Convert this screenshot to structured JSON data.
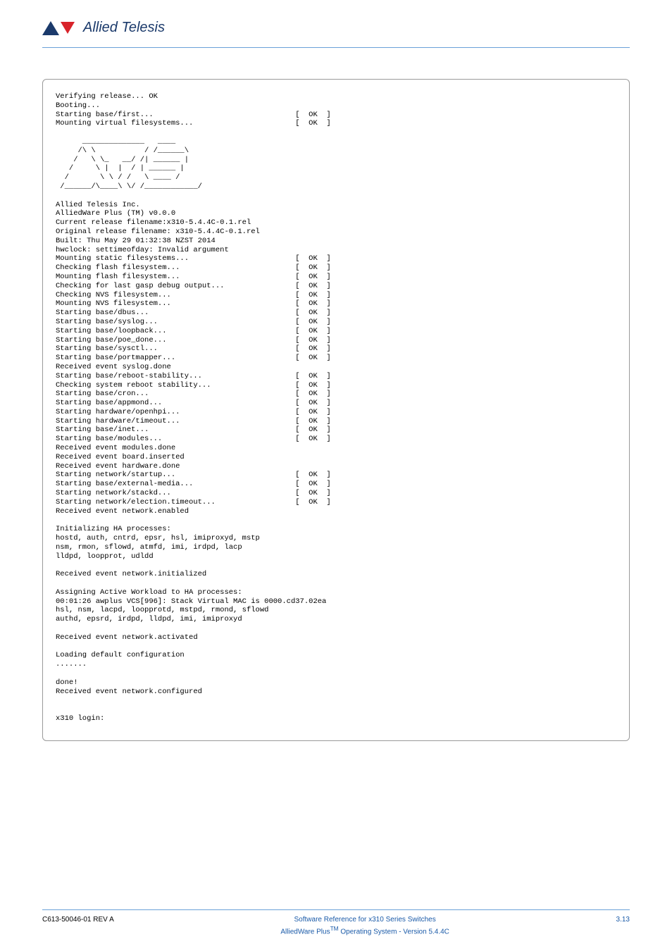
{
  "brand": "Allied Telesis",
  "terminal": "Verifying release... OK\nBooting...\nStarting base/first...                                [  OK  ]\nMounting virtual filesystems...                       [  OK  ]\n\n      ______________   ____\n     /\\ \\           / /______\\\n    /   \\ \\_   __/ /| ______ |\n   /     \\ |  |  / | ______ |\n  /       \\ \\ / /   \\ ____ /\n /______/\\____\\ \\/ /____________/\n\nAllied Telesis Inc.\nAlliedWare Plus (TM) v0.0.0\nCurrent release filename:x310-5.4.4C-0.1.rel\nOriginal release filename: x310-5.4.4C-0.1.rel\nBuilt: Thu May 29 01:32:38 NZST 2014\nhwclock: settimeofday: Invalid argument\nMounting static filesystems...                        [  OK  ]\nChecking flash filesystem...                          [  OK  ]\nMounting flash filesystem...                          [  OK  ]\nChecking for last gasp debug output...                [  OK  ]\nChecking NVS filesystem...                            [  OK  ]\nMounting NVS filesystem...                            [  OK  ]\nStarting base/dbus...                                 [  OK  ]\nStarting base/syslog...                               [  OK  ]\nStarting base/loopback...                             [  OK  ]\nStarting base/poe_done...                             [  OK  ]\nStarting base/sysctl...                               [  OK  ]\nStarting base/portmapper...                           [  OK  ]\nReceived event syslog.done\nStarting base/reboot-stability...                     [  OK  ]\nChecking system reboot stability...                   [  OK  ]\nStarting base/cron...                                 [  OK  ]\nStarting base/appmond...                              [  OK  ]\nStarting hardware/openhpi...                          [  OK  ]\nStarting hardware/timeout...                          [  OK  ]\nStarting base/inet...                                 [  OK  ]\nStarting base/modules...                              [  OK  ]\nReceived event modules.done\nReceived event board.inserted\nReceived event hardware.done\nStarting network/startup...                           [  OK  ]\nStarting base/external-media...                       [  OK  ]\nStarting network/stackd...                            [  OK  ]\nStarting network/election.timeout...                  [  OK  ]\nReceived event network.enabled\n\nInitializing HA processes:\nhostd, auth, cntrd, epsr, hsl, imiproxyd, mstp\nnsm, rmon, sflowd, atmfd, imi, irdpd, lacp\nlldpd, loopprot, udldd\n\nReceived event network.initialized\n\nAssigning Active Workload to HA processes:\n00:01:26 awplus VCS[996]: Stack Virtual MAC is 0000.cd37.02ea\nhsl, nsm, lacpd, loopprotd, mstpd, rmond, sflowd\nauthd, epsrd, irdpd, lldpd, imi, imiproxyd\n\nReceived event network.activated\n\nLoading default configuration\n.......\n\ndone!\nReceived event network.configured\n\n\nx310 login:\n",
  "footer": {
    "left": "C613-50046-01 REV A",
    "center_line1": "Software Reference for x310 Series Switches",
    "center_line2_prefix": "AlliedWare Plus",
    "center_line2_tm": "TM",
    "center_line2_suffix": " Operating System - Version 5.4.4C",
    "right": "3.13"
  }
}
